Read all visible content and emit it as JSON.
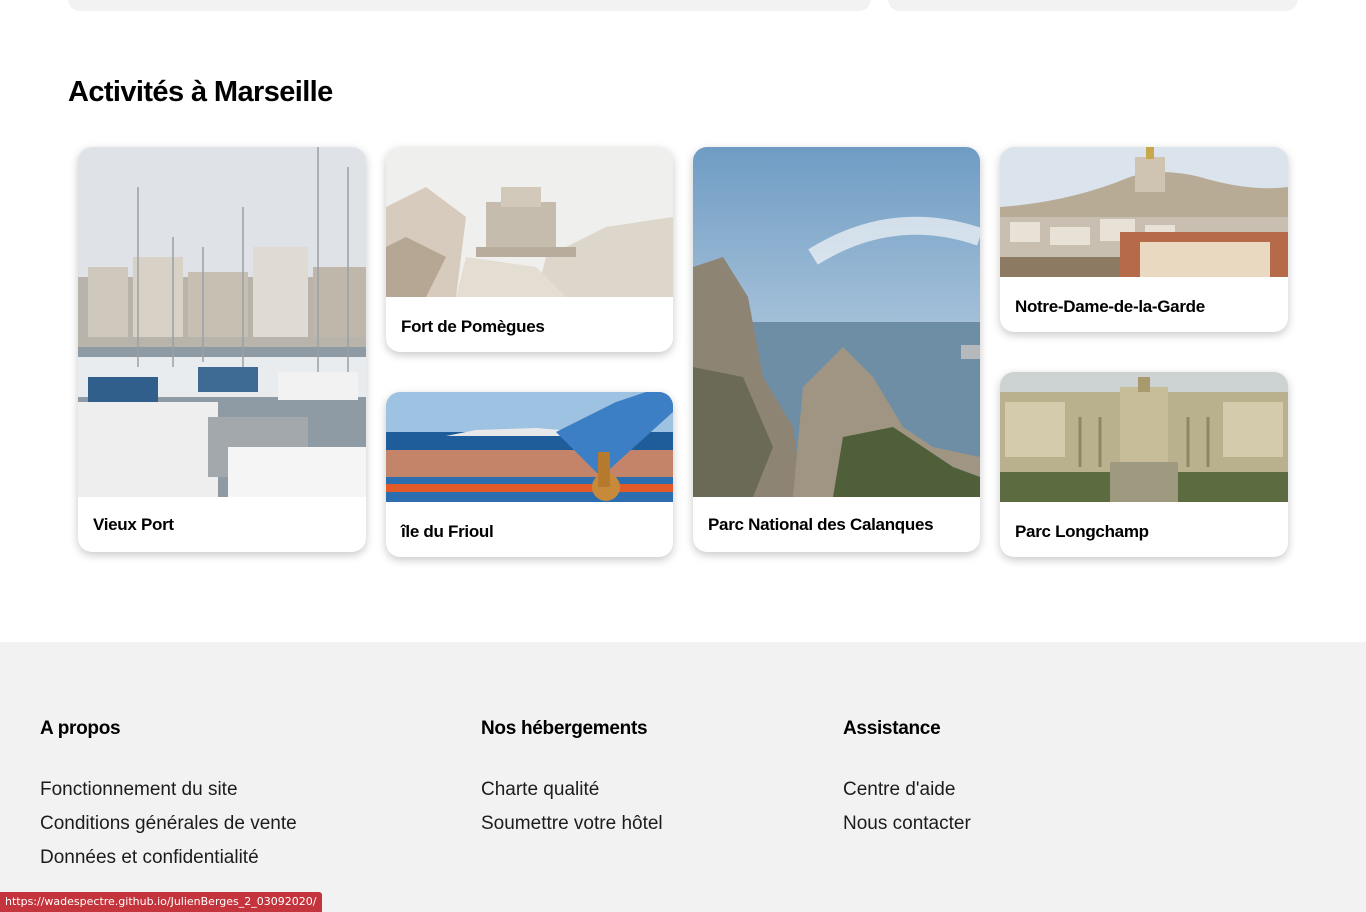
{
  "section": {
    "title": "Activités à Marseille"
  },
  "activities": [
    {
      "label": "Vieux Port",
      "image": "harbor-photo"
    },
    {
      "label": "Fort de Pomègues",
      "image": "fort-photo"
    },
    {
      "label": "île du Frioul",
      "image": "island-photo"
    },
    {
      "label": "Parc National des Calanques",
      "image": "calanques-photo"
    },
    {
      "label": "Notre-Dame-de-la-Garde",
      "image": "basilica-photo"
    },
    {
      "label": "Parc Longchamp",
      "image": "palace-photo"
    }
  ],
  "footer": {
    "about": {
      "heading": "A propos",
      "links": [
        "Fonctionnement du site",
        "Conditions générales de vente",
        "Données et confidentialité"
      ]
    },
    "hosting": {
      "heading": "Nos hébergements",
      "links": [
        "Charte qualité",
        "Soumettre votre hôtel"
      ]
    },
    "support": {
      "heading": "Assistance",
      "links": [
        "Centre d'aide",
        "Nous contacter"
      ]
    }
  },
  "status_bar": {
    "url": "https://wadespectre.github.io/JulienBerges_2_03092020/"
  }
}
